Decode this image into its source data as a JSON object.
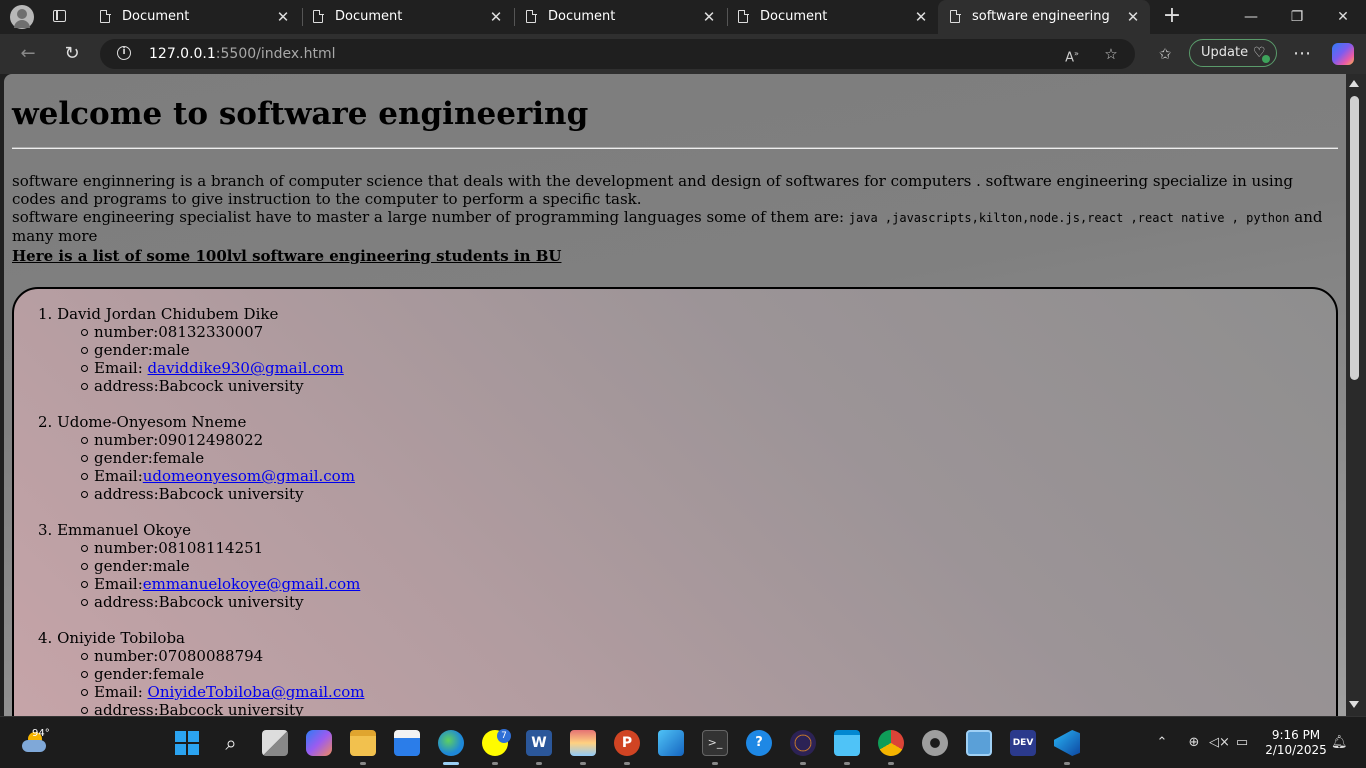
{
  "browser": {
    "tabs": [
      {
        "title": "Document"
      },
      {
        "title": "Document"
      },
      {
        "title": "Document"
      },
      {
        "title": "Document"
      },
      {
        "title": "software engineering"
      }
    ],
    "new_tab_symbol": "+",
    "window_controls": {
      "minimize": "—",
      "restore": "❐",
      "close": "✕"
    },
    "address": {
      "host": "127.0.0.1",
      "rest": ":5500/index.html"
    },
    "update_label": "Update",
    "icons": [
      "profile-icon",
      "tab-actions-icon",
      "page-icon",
      "back-icon",
      "refresh-icon",
      "info-icon",
      "read-aloud-icon",
      "favorite-icon",
      "favorites-icon",
      "more-icon",
      "copilot-icon"
    ]
  },
  "page": {
    "heading": "welcome to software engineering",
    "paragraph_1": "software enginnering is a branch of computer science that deals with the development and design of softwares for computers . software engineering specialize in using codes and programs to give instruction to the computer to perform a specific task.",
    "paragraph_2_prefix": "software engineering specialist have to master a large number of programming languages some of them are:",
    "languages_code": "java ,javascripts,kilton,node.js,react ,react native , python",
    "paragraph_2_suffix": "and many more",
    "list_heading": "Here is a list of some 100lvl software engineering students in BU",
    "students": [
      {
        "name": "1. David Jordan Chidubem Dike",
        "number": "number:08132330007",
        "gender": "gender:male",
        "email_prefix": "Email: ",
        "email": "daviddike930@gmail.com",
        "address": "address:Babcock university"
      },
      {
        "name": "2. Udome-Onyesom Nneme",
        "number": "number:09012498022",
        "gender": "gender:female",
        "email_prefix": "Email:",
        "email": "udomeonyesom@gmail.com",
        "address": "address:Babcock university"
      },
      {
        "name": "3. Emmanuel Okoye",
        "number": "number:08108114251",
        "gender": "gender:male",
        "email_prefix": "Email:",
        "email": "emmanuelokoye@gmail.com",
        "address": "address:Babcock university"
      },
      {
        "name": "4. Oniyide Tobiloba",
        "number": "number:07080088794",
        "gender": "gender:female",
        "email_prefix": "Email: ",
        "email": "OniyideTobiloba@gmail.com",
        "address": "address:Babcock university"
      }
    ],
    "colors": {
      "link": "#0000ee",
      "page_bg": "#808080",
      "card_pink": "#c8a5a9"
    }
  },
  "taskbar": {
    "weather_temp": "94°",
    "badge_count": "7",
    "time": "9:16 PM",
    "date": "2/10/2025",
    "apps": [
      "start-icon",
      "search-icon",
      "task-view-icon",
      "copilot-icon",
      "file-explorer-icon",
      "store-icon",
      "edge-icon",
      "snapchat-icon",
      "word-icon",
      "layers-app-icon",
      "powerpoint-icon",
      "photos-icon",
      "terminal-icon",
      "help-icon",
      "eclipse-icon",
      "notepad-icon",
      "chrome-icon",
      "settings-icon",
      "remote-desktop-icon",
      "dev-home-icon",
      "vscode-icon"
    ],
    "tray": [
      "chevron-up-icon",
      "network-icon",
      "volume-muted-icon",
      "battery-icon",
      "notification-bell-icon"
    ]
  }
}
